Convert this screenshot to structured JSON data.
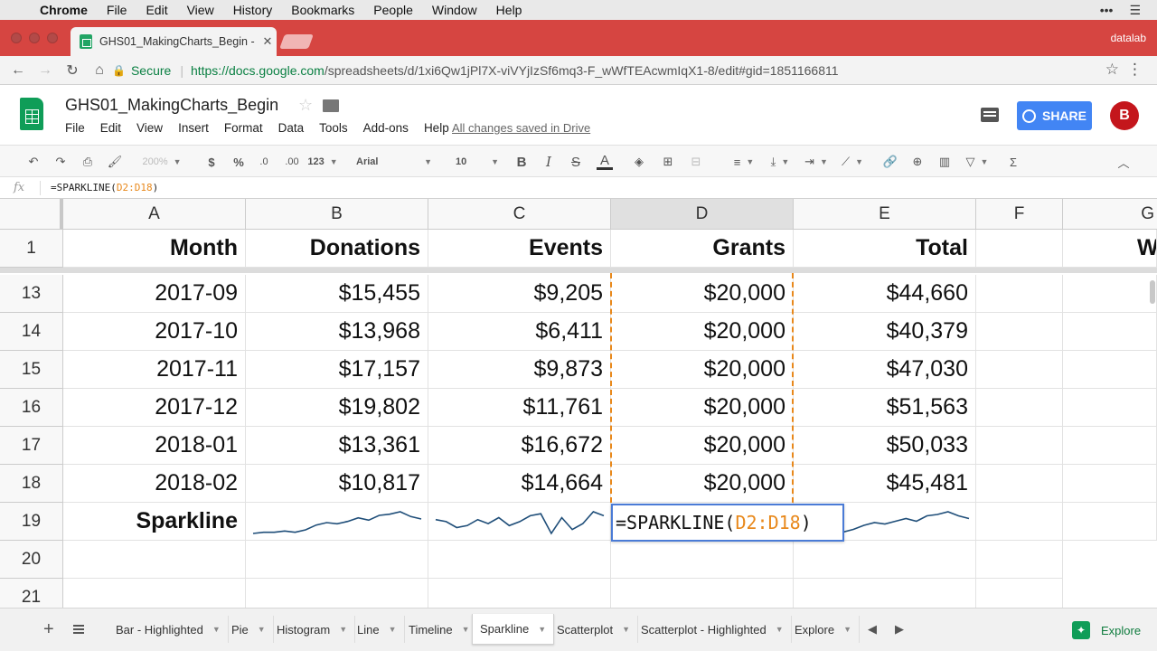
{
  "os_menu": {
    "app": "Chrome",
    "items": [
      "File",
      "Edit",
      "View",
      "History",
      "Bookmarks",
      "People",
      "Window",
      "Help"
    ]
  },
  "browser": {
    "tab_title": "GHS01_MakingCharts_Begin -",
    "profile": "datalab",
    "secure_label": "Secure",
    "url_host": "https://docs.google.com",
    "url_path": "/spreadsheets/d/1xi6Qw1jPl7X-viVYjIzSf6mq3-F_wWfTEAcwmIqX1-8/edit#gid=1851166811"
  },
  "doc": {
    "title": "GHS01_MakingCharts_Begin",
    "menu": [
      "File",
      "Edit",
      "View",
      "Insert",
      "Format",
      "Data",
      "Tools",
      "Add-ons",
      "Help"
    ],
    "save_status": "All changes saved in Drive",
    "share_label": "SHARE",
    "avatar_initial": "B"
  },
  "toolbar": {
    "zoom": "200%",
    "currency": "$",
    "percent": "%",
    "dec_decrease": ".0",
    "dec_increase": ".00",
    "more_formats": "123",
    "font": "Arial",
    "font_size": "10"
  },
  "formula_bar": {
    "fx": "fx",
    "prefix": "=SPARKLINE(",
    "ref": "D2:D18",
    "suffix": ")"
  },
  "grid": {
    "columns": [
      "A",
      "B",
      "C",
      "D",
      "E",
      "F",
      "G"
    ],
    "header_row": {
      "row": "1",
      "cells": [
        "Month",
        "Donations",
        "Events",
        "Grants",
        "Total",
        "",
        "W"
      ]
    },
    "rows": [
      {
        "row": "13",
        "cells": [
          "2017-09",
          "$15,455",
          "$9,205",
          "$20,000",
          "$44,660"
        ]
      },
      {
        "row": "14",
        "cells": [
          "2017-10",
          "$13,968",
          "$6,411",
          "$20,000",
          "$40,379"
        ]
      },
      {
        "row": "15",
        "cells": [
          "2017-11",
          "$17,157",
          "$9,873",
          "$20,000",
          "$47,030"
        ]
      },
      {
        "row": "16",
        "cells": [
          "2017-12",
          "$19,802",
          "$11,761",
          "$20,000",
          "$51,563"
        ]
      },
      {
        "row": "17",
        "cells": [
          "2018-01",
          "$13,361",
          "$16,672",
          "$20,000",
          "$50,033"
        ]
      },
      {
        "row": "18",
        "cells": [
          "2018-02",
          "$10,817",
          "$14,664",
          "$20,000",
          "$45,481"
        ]
      }
    ],
    "sparkline_row": {
      "row": "19",
      "label": "Sparkline"
    },
    "empty_rows": [
      "20",
      "21"
    ],
    "sparkline_color": "#1f4e79",
    "range_highlight_color": "#e8881b",
    "active_column": "D"
  },
  "sparklines": {
    "donations": [
      2,
      3,
      3,
      4,
      3,
      5,
      9,
      11,
      10,
      12,
      15,
      13,
      17,
      18,
      20,
      16,
      14
    ],
    "events": [
      12,
      11,
      8,
      9,
      12,
      10,
      13,
      9,
      11,
      14,
      15,
      5,
      13,
      7,
      10,
      16,
      14
    ],
    "total": [
      3,
      4,
      3,
      5,
      4,
      6,
      9,
      11,
      10,
      12,
      14,
      12,
      16,
      17,
      19,
      16,
      14
    ]
  },
  "editor": {
    "prefix": "=SPARKLINE(",
    "ref": "D2:D18",
    "suffix": ")"
  },
  "sheet_tabs": {
    "tabs": [
      "Bar - Highlighted",
      "Pie",
      "Histogram",
      "Line",
      "Timeline",
      "Sparkline",
      "Scatterplot",
      "Scatterplot - Highlighted",
      "Explore"
    ],
    "active": "Sparkline",
    "explore_label": "Explore"
  }
}
